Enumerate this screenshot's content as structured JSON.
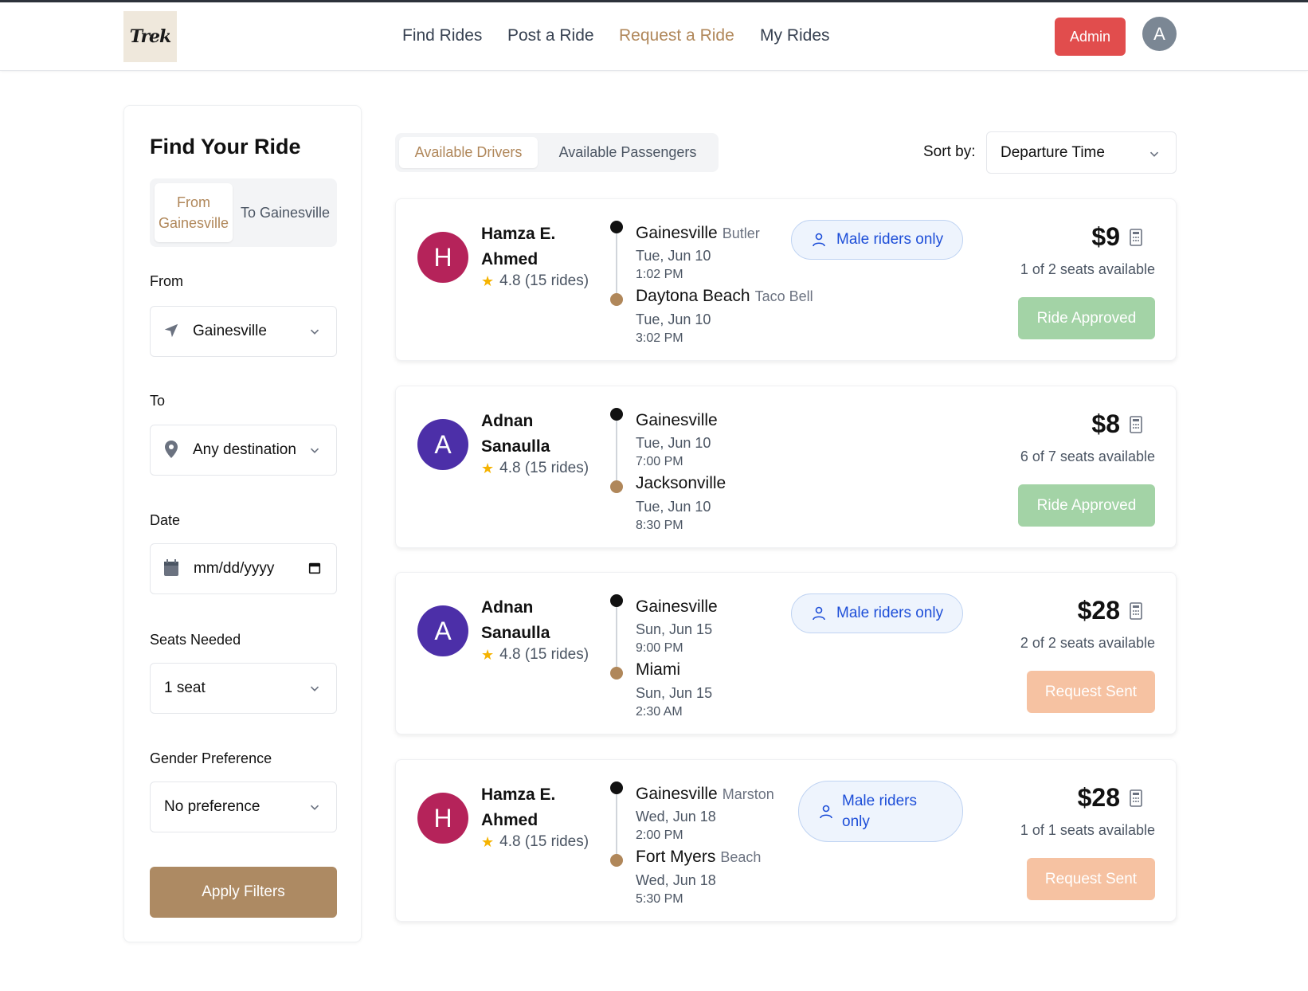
{
  "header": {
    "logo_text": "Trek",
    "nav": [
      {
        "label": "Find Rides",
        "active": false
      },
      {
        "label": "Post a Ride",
        "active": false
      },
      {
        "label": "Request a Ride",
        "active": true
      },
      {
        "label": "My Rides",
        "active": false
      }
    ],
    "admin_label": "Admin",
    "user_initial": "A"
  },
  "sidebar": {
    "title": "Find Your Ride",
    "direction": {
      "from_label": "From Gainesville",
      "to_label": "To Gainesville"
    },
    "from": {
      "label": "From",
      "value": "Gainesville",
      "icon": "navigation-arrow-icon"
    },
    "to": {
      "label": "To",
      "value": "Any destination",
      "icon": "map-pin-icon"
    },
    "date": {
      "label": "Date",
      "placeholder": "mm/dd/yyyy",
      "icon": "calendar-icon"
    },
    "seats": {
      "label": "Seats Needed",
      "value": "1 seat"
    },
    "gender": {
      "label": "Gender Preference",
      "value": "No preference"
    },
    "apply_label": "Apply Filters"
  },
  "main": {
    "tabs": [
      {
        "label": "Available Drivers",
        "active": true
      },
      {
        "label": "Available Passengers",
        "active": false
      }
    ],
    "sort": {
      "label": "Sort by:",
      "value": "Departure Time"
    },
    "rides": [
      {
        "driver": "Hamza E. Ahmed",
        "initial": "H",
        "avatar_color": "#b5235a",
        "rating": "4.8 (15 rides)",
        "from": {
          "city": "Gainesville",
          "location": "Butler",
          "date": "Tue, Jun 10",
          "time": "1:02 PM"
        },
        "to": {
          "city": "Daytona Beach",
          "location": "Taco Bell",
          "date": "Tue, Jun 10",
          "time": "3:02 PM"
        },
        "preference": "Male riders only",
        "price": "$9",
        "seats": "1 of 2 seats available",
        "status": "Ride Approved",
        "status_type": "approved"
      },
      {
        "driver": "Adnan Sanaulla",
        "initial": "A",
        "avatar_color": "#4c2fa8",
        "rating": "4.8 (15 rides)",
        "from": {
          "city": "Gainesville",
          "location": "",
          "date": "Tue, Jun 10",
          "time": "7:00 PM"
        },
        "to": {
          "city": "Jacksonville",
          "location": "",
          "date": "Tue, Jun 10",
          "time": "8:30 PM"
        },
        "preference": "",
        "price": "$8",
        "seats": "6 of 7 seats available",
        "status": "Ride Approved",
        "status_type": "approved"
      },
      {
        "driver": "Adnan Sanaulla",
        "initial": "A",
        "avatar_color": "#4c2fa8",
        "rating": "4.8 (15 rides)",
        "from": {
          "city": "Gainesville",
          "location": "",
          "date": "Sun, Jun 15",
          "time": "9:00 PM"
        },
        "to": {
          "city": "Miami",
          "location": "",
          "date": "Sun, Jun 15",
          "time": "2:30 AM"
        },
        "preference": "Male riders only",
        "price": "$28",
        "seats": "2 of 2 seats available",
        "status": "Request Sent",
        "status_type": "sent"
      },
      {
        "driver": "Hamza E. Ahmed",
        "initial": "H",
        "avatar_color": "#b5235a",
        "rating": "4.8 (15 rides)",
        "from": {
          "city": "Gainesville",
          "location": "Marston",
          "date": "Wed, Jun 18",
          "time": "2:00 PM"
        },
        "to": {
          "city": "Fort Myers",
          "location": "Beach",
          "date": "Wed, Jun 18",
          "time": "5:30 PM"
        },
        "preference": "Male riders only",
        "price": "$28",
        "seats": "1 of 1 seats available",
        "status": "Request Sent",
        "status_type": "sent"
      }
    ]
  },
  "colors": {
    "accent": "#b0875a",
    "admin": "#e14d4d",
    "approved": "#a3d3a6",
    "sent": "#f6c2a2"
  }
}
